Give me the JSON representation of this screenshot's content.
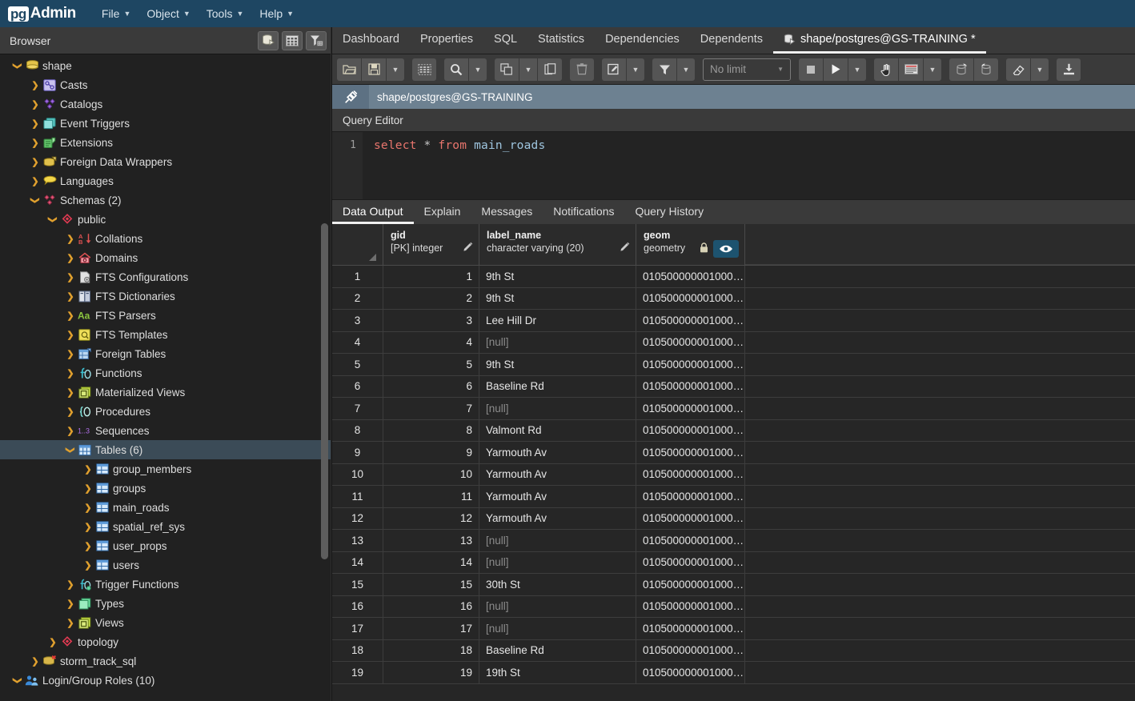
{
  "app": {
    "logo_pg": "pg",
    "logo_admin": "Admin",
    "menus": [
      {
        "label": "File",
        "icon": "chevron-down-icon"
      },
      {
        "label": "Object",
        "icon": "chevron-down-icon"
      },
      {
        "label": "Tools",
        "icon": "chevron-down-icon"
      },
      {
        "label": "Help",
        "icon": "chevron-down-icon"
      }
    ]
  },
  "browser": {
    "title": "Browser",
    "buttons": [
      {
        "name": "query-tool-button",
        "icon": "database-query-icon"
      },
      {
        "name": "view-data-button",
        "icon": "grid-icon"
      },
      {
        "name": "filter-button",
        "icon": "filter-icon"
      }
    ],
    "tree": [
      {
        "label": "shape",
        "depth": 1,
        "arrow": "expanded",
        "icon": "database-icon",
        "selected": false
      },
      {
        "label": "Casts",
        "depth": 2,
        "arrow": "collapsed",
        "icon": "casts-icon",
        "selected": false
      },
      {
        "label": "Catalogs",
        "depth": 2,
        "arrow": "collapsed",
        "icon": "catalogs-icon",
        "selected": false
      },
      {
        "label": "Event Triggers",
        "depth": 2,
        "arrow": "collapsed",
        "icon": "event-triggers-icon",
        "selected": false
      },
      {
        "label": "Extensions",
        "depth": 2,
        "arrow": "collapsed",
        "icon": "extensions-icon",
        "selected": false
      },
      {
        "label": "Foreign Data Wrappers",
        "depth": 2,
        "arrow": "collapsed",
        "icon": "foreign-data-wrappers-icon",
        "selected": false
      },
      {
        "label": "Languages",
        "depth": 2,
        "arrow": "collapsed",
        "icon": "languages-icon",
        "selected": false
      },
      {
        "label": "Schemas (2)",
        "depth": 2,
        "arrow": "expanded",
        "icon": "schemas-icon",
        "selected": false
      },
      {
        "label": "public",
        "depth": 3,
        "arrow": "expanded",
        "icon": "schema-icon",
        "selected": false
      },
      {
        "label": "Collations",
        "depth": 4,
        "arrow": "collapsed",
        "icon": "collations-icon",
        "selected": false
      },
      {
        "label": "Domains",
        "depth": 4,
        "arrow": "collapsed",
        "icon": "domains-icon",
        "selected": false
      },
      {
        "label": "FTS Configurations",
        "depth": 4,
        "arrow": "collapsed",
        "icon": "fts-configurations-icon",
        "selected": false
      },
      {
        "label": "FTS Dictionaries",
        "depth": 4,
        "arrow": "collapsed",
        "icon": "fts-dictionaries-icon",
        "selected": false
      },
      {
        "label": "FTS Parsers",
        "depth": 4,
        "arrow": "collapsed",
        "icon": "fts-parsers-icon",
        "selected": false
      },
      {
        "label": "FTS Templates",
        "depth": 4,
        "arrow": "collapsed",
        "icon": "fts-templates-icon",
        "selected": false
      },
      {
        "label": "Foreign Tables",
        "depth": 4,
        "arrow": "collapsed",
        "icon": "foreign-tables-icon",
        "selected": false
      },
      {
        "label": "Functions",
        "depth": 4,
        "arrow": "collapsed",
        "icon": "functions-icon",
        "selected": false
      },
      {
        "label": "Materialized Views",
        "depth": 4,
        "arrow": "collapsed",
        "icon": "materialized-views-icon",
        "selected": false
      },
      {
        "label": "Procedures",
        "depth": 4,
        "arrow": "collapsed",
        "icon": "procedures-icon",
        "selected": false
      },
      {
        "label": "Sequences",
        "depth": 4,
        "arrow": "collapsed",
        "icon": "sequences-icon",
        "selected": false
      },
      {
        "label": "Tables (6)",
        "depth": 4,
        "arrow": "expanded",
        "icon": "tables-icon",
        "selected": true
      },
      {
        "label": "group_members",
        "depth": 5,
        "arrow": "collapsed",
        "icon": "table-icon",
        "selected": false
      },
      {
        "label": "groups",
        "depth": 5,
        "arrow": "collapsed",
        "icon": "table-icon",
        "selected": false
      },
      {
        "label": "main_roads",
        "depth": 5,
        "arrow": "collapsed",
        "icon": "table-icon",
        "selected": false
      },
      {
        "label": "spatial_ref_sys",
        "depth": 5,
        "arrow": "collapsed",
        "icon": "table-icon",
        "selected": false
      },
      {
        "label": "user_props",
        "depth": 5,
        "arrow": "collapsed",
        "icon": "table-icon",
        "selected": false
      },
      {
        "label": "users",
        "depth": 5,
        "arrow": "collapsed",
        "icon": "table-icon",
        "selected": false
      },
      {
        "label": "Trigger Functions",
        "depth": 4,
        "arrow": "collapsed",
        "icon": "trigger-functions-icon",
        "selected": false
      },
      {
        "label": "Types",
        "depth": 4,
        "arrow": "collapsed",
        "icon": "types-icon",
        "selected": false
      },
      {
        "label": "Views",
        "depth": 4,
        "arrow": "collapsed",
        "icon": "views-icon",
        "selected": false
      },
      {
        "label": "topology",
        "depth": 3,
        "arrow": "collapsed",
        "icon": "schema-icon",
        "selected": false
      },
      {
        "label": "storm_track_sql",
        "depth": 2,
        "arrow": "collapsed",
        "icon": "database-disconnected-icon",
        "selected": false
      },
      {
        "label": "Login/Group Roles (10)",
        "depth": 1,
        "arrow": "expanded",
        "icon": "login-roles-icon",
        "selected": false
      }
    ]
  },
  "main": {
    "top_tabs": [
      {
        "label": "Dashboard",
        "active": false
      },
      {
        "label": "Properties",
        "active": false
      },
      {
        "label": "SQL",
        "active": false
      },
      {
        "label": "Statistics",
        "active": false
      },
      {
        "label": "Dependencies",
        "active": false
      },
      {
        "label": "Dependents",
        "active": false
      },
      {
        "label": "shape/postgres@GS-TRAINING *",
        "active": true,
        "icon": "query-tool-icon"
      }
    ],
    "toolbar": {
      "groups": [
        {
          "buttons": [
            {
              "name": "open-file-button",
              "icon": "folder-open-icon"
            },
            {
              "name": "save-file-button",
              "icon": "save-icon"
            },
            {
              "name": "save-dropdown-button",
              "icon": "chevron-down-icon"
            }
          ]
        },
        {
          "buttons": [
            {
              "name": "edit-paste-grid-button",
              "icon": "grid-paste-icon"
            }
          ]
        },
        {
          "buttons": [
            {
              "name": "find-button",
              "icon": "search-icon"
            },
            {
              "name": "find-dropdown-button",
              "icon": "chevron-down-icon"
            }
          ]
        },
        {
          "buttons": [
            {
              "name": "copy-button",
              "icon": "copy-icon"
            },
            {
              "name": "copy-dropdown-button",
              "icon": "chevron-down-icon"
            },
            {
              "name": "paste-button",
              "icon": "paste-icon"
            }
          ]
        },
        {
          "buttons": [
            {
              "name": "delete-row-button",
              "icon": "trash-icon"
            }
          ]
        },
        {
          "buttons": [
            {
              "name": "edit-button",
              "icon": "edit-pencil-icon"
            },
            {
              "name": "edit-dropdown-button",
              "icon": "chevron-down-icon"
            }
          ]
        },
        {
          "buttons": [
            {
              "name": "filter-button",
              "icon": "filter-icon"
            },
            {
              "name": "filter-dropdown-button",
              "icon": "chevron-down-icon"
            }
          ]
        }
      ],
      "limit": {
        "value": "No limit",
        "icon": "chevron-down-icon"
      },
      "groups2": [
        {
          "buttons": [
            {
              "name": "stop-query-button",
              "icon": "stop-icon"
            },
            {
              "name": "execute-query-button",
              "icon": "play-icon"
            },
            {
              "name": "execute-dropdown-button",
              "icon": "chevron-down-icon"
            }
          ]
        },
        {
          "buttons": [
            {
              "name": "explain-button",
              "icon": "hand-pointer-icon"
            },
            {
              "name": "explain-analyze-button",
              "icon": "explain-panel-icon"
            },
            {
              "name": "explain-dropdown-button",
              "icon": "chevron-down-icon"
            }
          ]
        },
        {
          "buttons": [
            {
              "name": "commit-button",
              "icon": "commit-icon"
            },
            {
              "name": "rollback-button",
              "icon": "rollback-icon"
            }
          ]
        },
        {
          "buttons": [
            {
              "name": "clear-button",
              "icon": "eraser-icon"
            },
            {
              "name": "clear-dropdown-button",
              "icon": "chevron-down-icon"
            }
          ]
        },
        {
          "buttons": [
            {
              "name": "download-csv-button",
              "icon": "download-icon"
            }
          ]
        }
      ]
    },
    "connection_bar": {
      "icon": "connection-icon",
      "text": "shape/postgres@GS-TRAINING"
    },
    "query_editor_label": "Query Editor",
    "query": {
      "line_number": "1",
      "tokens": [
        {
          "text": "select",
          "type": "keyword"
        },
        {
          "text": " ",
          "type": "plain"
        },
        {
          "text": "*",
          "type": "operator"
        },
        {
          "text": " ",
          "type": "plain"
        },
        {
          "text": "from",
          "type": "keyword"
        },
        {
          "text": " ",
          "type": "plain"
        },
        {
          "text": "main_roads",
          "type": "identifier"
        }
      ],
      "full_text": "select * from main_roads"
    },
    "output_tabs": [
      {
        "label": "Data Output",
        "active": true
      },
      {
        "label": "Explain",
        "active": false
      },
      {
        "label": "Messages",
        "active": false
      },
      {
        "label": "Notifications",
        "active": false
      },
      {
        "label": "Query History",
        "active": false
      }
    ],
    "grid": {
      "columns": [
        {
          "name": "gid",
          "type": "[PK] integer",
          "editable": true,
          "locked": false,
          "align": "right"
        },
        {
          "name": "label_name",
          "type": "character varying (20)",
          "editable": true,
          "locked": false,
          "align": "left"
        },
        {
          "name": "geom",
          "type": "geometry",
          "editable": false,
          "locked": true,
          "view_geometry": true,
          "align": "left"
        }
      ],
      "null_text": "[null]",
      "rows": [
        {
          "n": "1",
          "gid": "1",
          "label_name": "9th St",
          "geom": "010500000001000…"
        },
        {
          "n": "2",
          "gid": "2",
          "label_name": "9th St",
          "geom": "010500000001000…"
        },
        {
          "n": "3",
          "gid": "3",
          "label_name": "Lee Hill Dr",
          "geom": "010500000001000…"
        },
        {
          "n": "4",
          "gid": "4",
          "label_name": null,
          "geom": "010500000001000…"
        },
        {
          "n": "5",
          "gid": "5",
          "label_name": "9th St",
          "geom": "010500000001000…"
        },
        {
          "n": "6",
          "gid": "6",
          "label_name": "Baseline Rd",
          "geom": "010500000001000…"
        },
        {
          "n": "7",
          "gid": "7",
          "label_name": null,
          "geom": "010500000001000…"
        },
        {
          "n": "8",
          "gid": "8",
          "label_name": "Valmont Rd",
          "geom": "010500000001000…"
        },
        {
          "n": "9",
          "gid": "9",
          "label_name": "Yarmouth Av",
          "geom": "010500000001000…"
        },
        {
          "n": "10",
          "gid": "10",
          "label_name": "Yarmouth Av",
          "geom": "010500000001000…"
        },
        {
          "n": "11",
          "gid": "11",
          "label_name": "Yarmouth Av",
          "geom": "010500000001000…"
        },
        {
          "n": "12",
          "gid": "12",
          "label_name": "Yarmouth Av",
          "geom": "010500000001000…"
        },
        {
          "n": "13",
          "gid": "13",
          "label_name": null,
          "geom": "010500000001000…"
        },
        {
          "n": "14",
          "gid": "14",
          "label_name": null,
          "geom": "010500000001000…"
        },
        {
          "n": "15",
          "gid": "15",
          "label_name": "30th St",
          "geom": "010500000001000…"
        },
        {
          "n": "16",
          "gid": "16",
          "label_name": null,
          "geom": "010500000001000…"
        },
        {
          "n": "17",
          "gid": "17",
          "label_name": null,
          "geom": "010500000001000…"
        },
        {
          "n": "18",
          "gid": "18",
          "label_name": "Baseline Rd",
          "geom": "010500000001000…"
        },
        {
          "n": "19",
          "gid": "19",
          "label_name": "19th St",
          "geom": "010500000001000…"
        }
      ]
    }
  },
  "colors": {
    "menubar": "#1e4662",
    "panel": "#3a3a3a",
    "tree_bg": "#212121",
    "selected_row": "#3b4b57",
    "grid_bg": "#262626",
    "accent_white": "#f0f0f0",
    "conn_bar": "#6d8191",
    "eye_button": "#1d536f",
    "keyword": "#e8756d",
    "identifier": "#9fc6e0",
    "arrow": "#e0a02e"
  }
}
